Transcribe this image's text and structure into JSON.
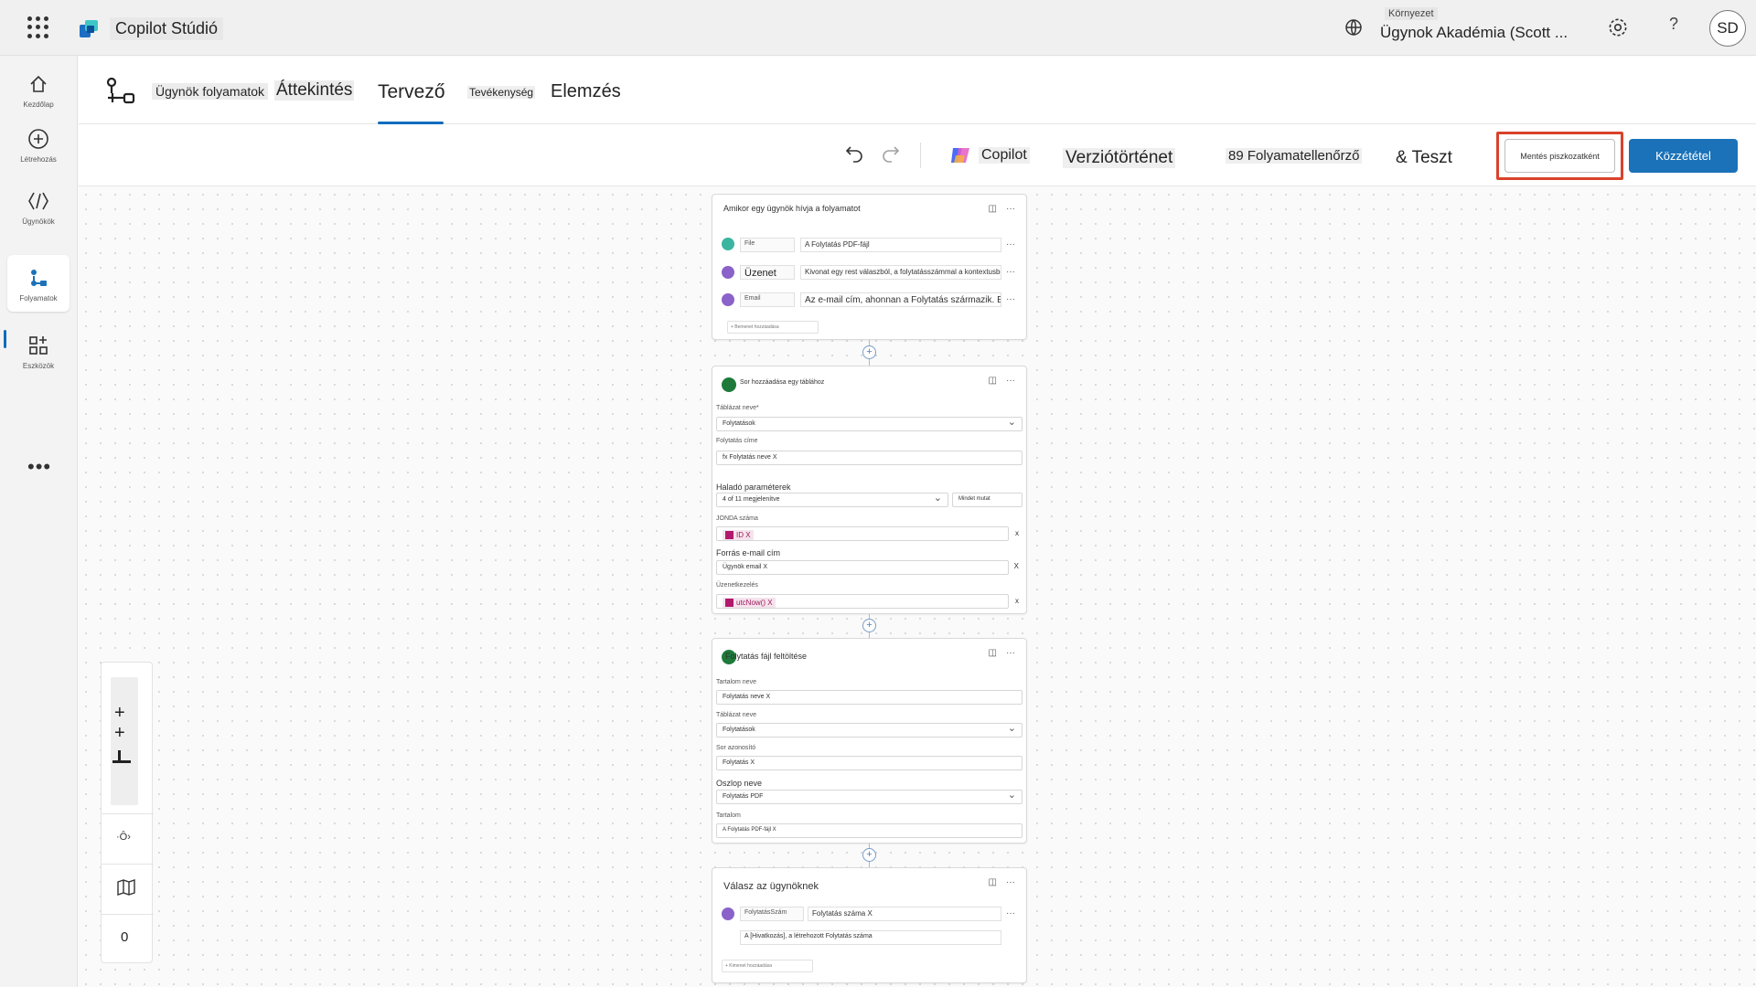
{
  "app": {
    "name": "Copilot Stúdió"
  },
  "environment": {
    "label": "Környezet",
    "name": "Ügynok Akadémia (Scott ..."
  },
  "user": {
    "initials": "SD"
  },
  "top_help": "?",
  "rail": {
    "items": [
      {
        "label": "Kezdőlap",
        "icon": "home-icon"
      },
      {
        "label": "Létrehozás",
        "icon": "plus-circle-icon"
      },
      {
        "label": "Ügynökök",
        "icon": "agents-icon"
      },
      {
        "label": "Folyamatok",
        "icon": "flows-icon"
      },
      {
        "label": "Eszközök",
        "icon": "tools-icon"
      }
    ],
    "more": "•••"
  },
  "subheader": {
    "flow_name": "Ügynök folyamatok",
    "tabs": [
      "Áttekintés",
      "Tervező",
      "Tevékenység",
      "Elemzés"
    ],
    "active_tab": "Tervező"
  },
  "toolbar": {
    "copilot": "Copilot",
    "version_history": "Verziótörténet",
    "flow_checker": "89 Folyamatellenőrző",
    "test": "& Teszt",
    "save_draft": "Mentés piszkozatként",
    "publish": "Közzététel"
  },
  "zoom": {
    "value": "0"
  },
  "nodes": {
    "trigger": {
      "title": "Amikor egy ügynök hívja a folyamatot",
      "rows": [
        {
          "key": "File",
          "value": "A Folytatás PDF-fájl"
        },
        {
          "key": "Üzenet",
          "value": "Kivonat egy rest válaszból, a folytatásszámmal a kontextusból A"
        },
        {
          "key": "Email",
          "value": "Az e-mail cím, ahonnan a Folytatás származik. Ez"
        }
      ],
      "add_input": "+ Bemenet hozzáadása"
    },
    "add_row": {
      "title": "Sor hozzáadása egy táblához",
      "table_label": "Táblázat neve*",
      "table_value": "Folytatások",
      "name_label": "Folytatás címe",
      "name_value": "fx Folytatás neve X",
      "adv_label": "Haladó paraméterek",
      "adv_value": "4 of 11 megjelenítve",
      "adv_btn": "Mindet mutat",
      "code_label": "JONDA száma",
      "code_value": "ID X",
      "source_label": "Forrás e-mail cím",
      "source_value": "Ügynök email X",
      "upload_label": "Üzenetkezelés",
      "upload_value": "utcNow() X"
    },
    "upload": {
      "title": "Folytatás fájl feltöltése",
      "name_label": "Tartalom neve",
      "name_value": "Folytatás neve X",
      "table_label": "Táblázat neve",
      "table_value": "Folytatások",
      "row_label": "Sor azonosító",
      "row_value": "Folytatás X",
      "col_label": "Oszlop neve",
      "col_value": "Folytatás PDF",
      "content_label": "Tartalom",
      "content_value": "A Folytatás PDF-fájl X"
    },
    "respond": {
      "title": "Válasz az ügynöknek",
      "row_key": "FolytatásSzám",
      "row_value": "Folytatás száma X",
      "desc": "A [Hivatkozás], a létrehozott Folytatás száma",
      "add_output": "+ Kimenet hozzáadása"
    }
  }
}
